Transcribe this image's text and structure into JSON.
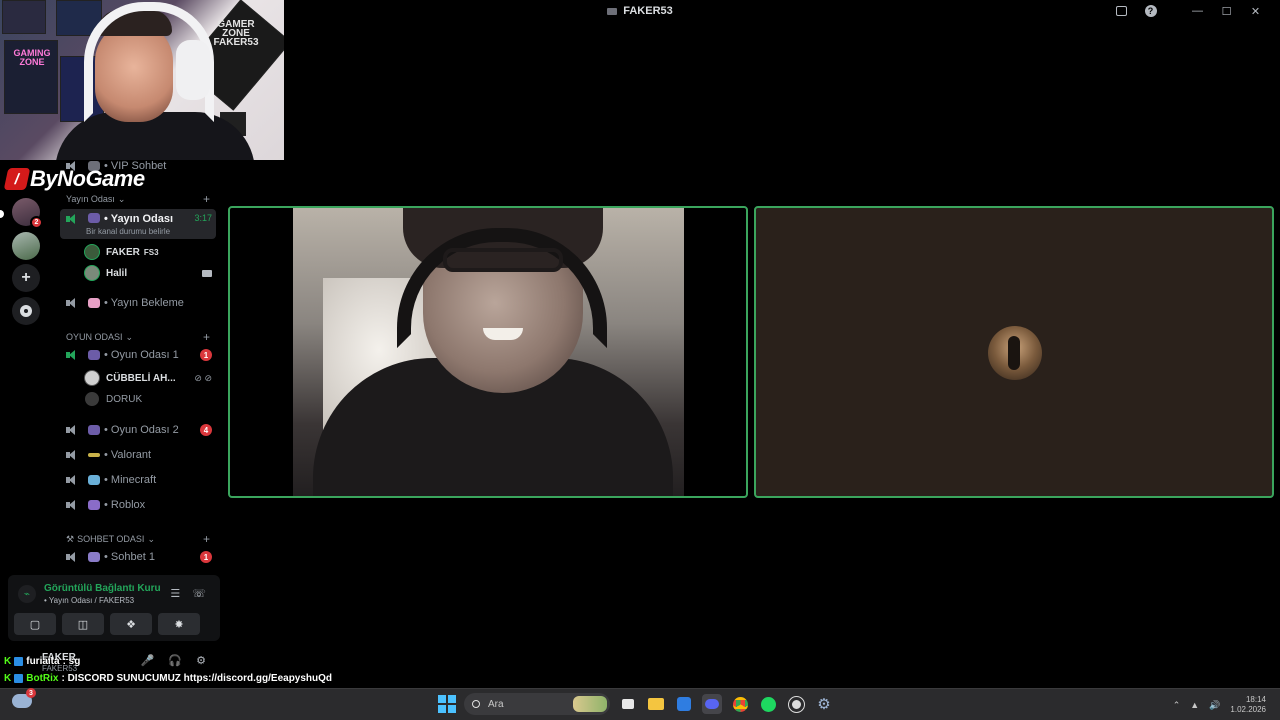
{
  "window": {
    "title": "FAKER53",
    "controls": [
      "minimize",
      "maximize",
      "close"
    ]
  },
  "stream_overlay": {
    "brand": "ByNoGame",
    "webcam_posters": [
      "GAMING ZONE",
      "GAMER ZONE FAKER53"
    ]
  },
  "server_rail": {
    "mention_count": "2",
    "add_label": "+",
    "items": [
      "server-avatar",
      "server-avatar",
      "add-server",
      "explore"
    ]
  },
  "channels": {
    "vip": "• VIP Sohbet",
    "cat_yayin": "Yayın Odası",
    "active_channel": "• Yayın Odası",
    "active_time": "3:17",
    "active_status": "Bir kanal durumu belirle",
    "users_yayin": [
      {
        "name": "FAKER",
        "tag": "FS3"
      },
      {
        "name": "Halil"
      }
    ],
    "bekleme": "• Yayın Bekleme",
    "cat_oyun": "OYUN ODASI",
    "oyun1": "• Oyun Odası 1",
    "oyun1_badge": "1",
    "users_oyun1": [
      {
        "name": "CÜBBELİ AH..."
      },
      {
        "name": "DORUK"
      }
    ],
    "oyun2": "• Oyun Odası 2",
    "oyun2_badge": "4",
    "valorant": "• Valorant",
    "minecraft": "• Minecraft",
    "roblox": "• Roblox",
    "cat_sohbet": "SOHBET ODASI",
    "sohbet1": "• Sohbet 1",
    "sohbet1_badge": "1"
  },
  "voice_panel": {
    "title": "Görüntülü Bağlantı Kuru",
    "subtitle": "• Yayın Odası / FAKER53"
  },
  "user_bar": {
    "name": "FAKER",
    "sub": "FAKER53"
  },
  "chat_overlay": [
    {
      "user": "furiaita",
      "message": ": sg"
    },
    {
      "user": "BotRix",
      "message": ": DISCORD SUNUCUMUZ https://discord.gg/EeapyshuQd"
    }
  ],
  "taskbar": {
    "search_placeholder": "Ara",
    "weather_badge": "3",
    "clock_time": "18:14",
    "clock_date": "1.02.2026"
  },
  "colors": {
    "speaking_border": "#3ba55d",
    "accent_green": "#23a55a",
    "badge_red": "#da373c"
  }
}
